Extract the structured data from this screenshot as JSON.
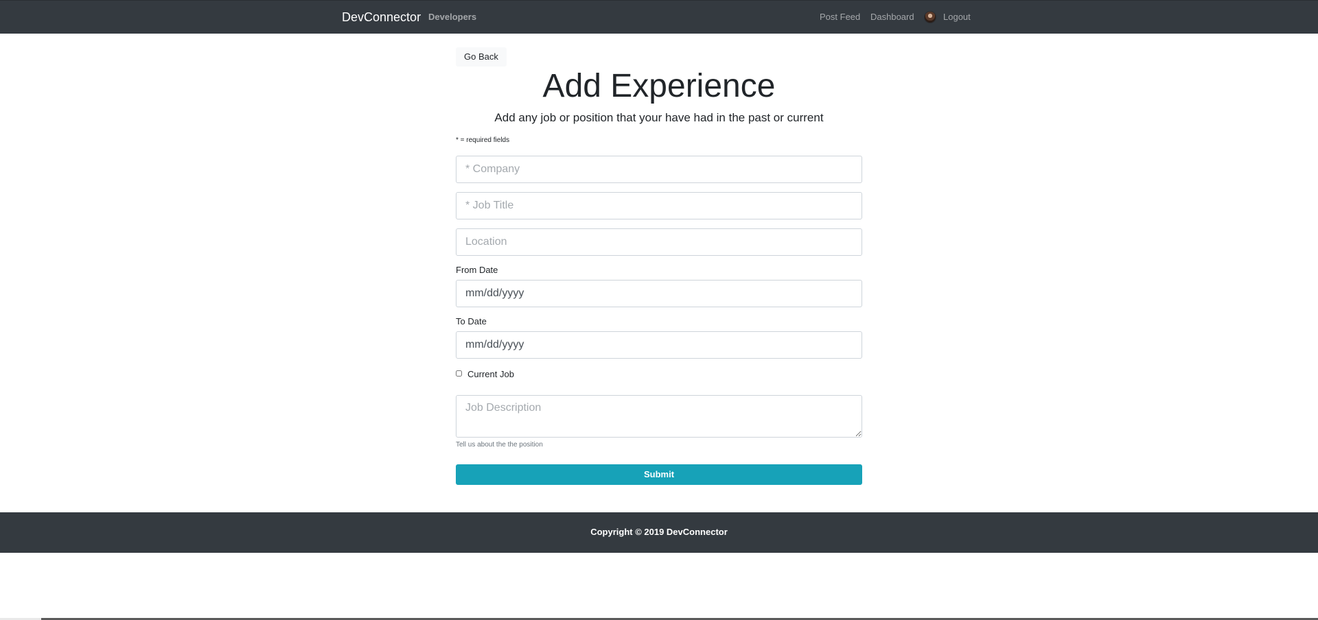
{
  "navbar": {
    "brand": "DevConnector",
    "developers": "Developers",
    "post_feed": "Post Feed",
    "dashboard": "Dashboard",
    "logout": "Logout",
    "avatar_icon": "user-avatar"
  },
  "form": {
    "back_label": "Go Back",
    "title": "Add Experience",
    "lead": "Add any job or position that your have had in the past or current",
    "required_note": "* = required fields",
    "company_placeholder": "* Company",
    "job_title_placeholder": "* Job Title",
    "location_placeholder": "Location",
    "from_label": "From Date",
    "from_value": "mm/dd/yyyy",
    "to_label": "To Date",
    "to_value": "mm/dd/yyyy",
    "current_label": "Current Job",
    "current_checked": false,
    "description_placeholder": "Job Description",
    "description_help": "Tell us about the the position",
    "submit_label": "Submit"
  },
  "footer": {
    "text": "Copyright © 2019 DevConnector"
  },
  "colors": {
    "navbar_bg": "#343a40",
    "accent": "#17a2b8",
    "footer_bg": "#343a40"
  }
}
